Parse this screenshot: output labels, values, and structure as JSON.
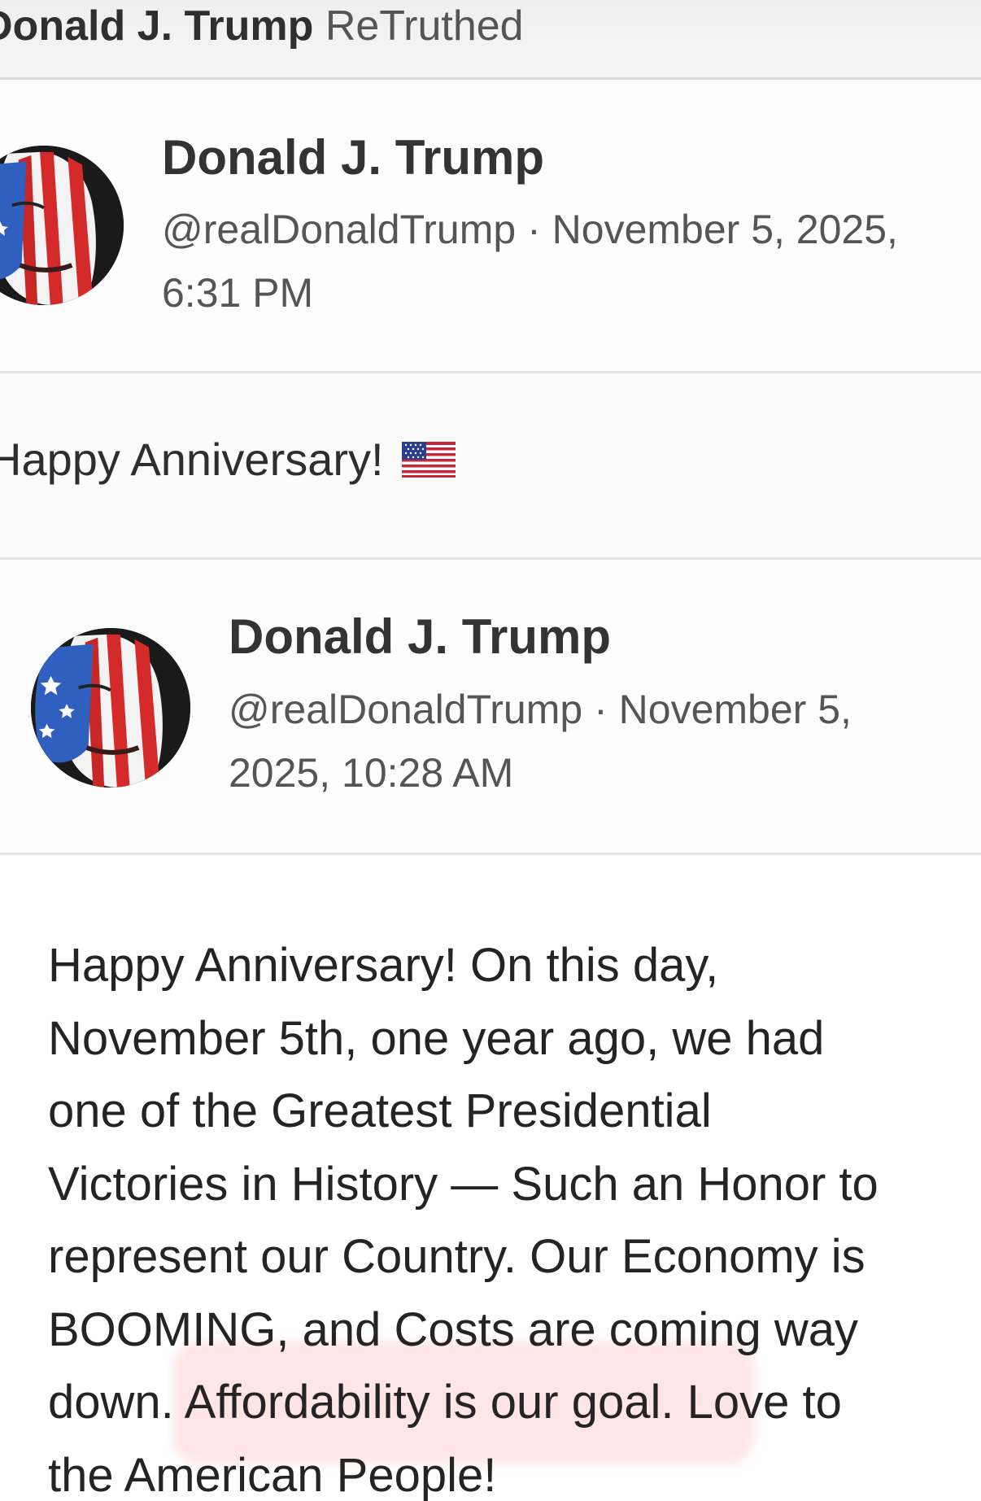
{
  "retruth_header": {
    "name": "Donald J. Trump",
    "action": "ReTruthed"
  },
  "retruth_post": {
    "author": {
      "display_name": "Donald J. Trump",
      "handle": "@realDonaldTrump",
      "separator": "·",
      "timestamp_line1": "November 5, 2025,",
      "timestamp_line2": "6:31 PM",
      "avatar": "flag-face-avatar"
    },
    "comment": {
      "text": "Happy Anniversary!",
      "emoji": "us-flag-emoji"
    }
  },
  "original_post": {
    "author": {
      "display_name": "Donald J. Trump",
      "handle": "@realDonaldTrump",
      "separator": "·",
      "timestamp_line1": "November 5,",
      "timestamp_line2": "2025, 10:28 AM",
      "avatar": "flag-face-avatar"
    },
    "body_lines": [
      "Happy Anniversary! On this day,",
      "November 5th, one year ago, we had",
      "one of the Greatest Presidential",
      "Victories in History — Such an Honor to",
      "represent our Country. Our Economy is",
      "BOOMING, and Costs are coming way",
      "down. Affordability is our goal. Love to",
      "the American People!"
    ]
  },
  "colors": {
    "highlight": "#ffafaf",
    "divider": "#e4e4e4",
    "text_primary": "#333333",
    "text_secondary": "#555555"
  }
}
